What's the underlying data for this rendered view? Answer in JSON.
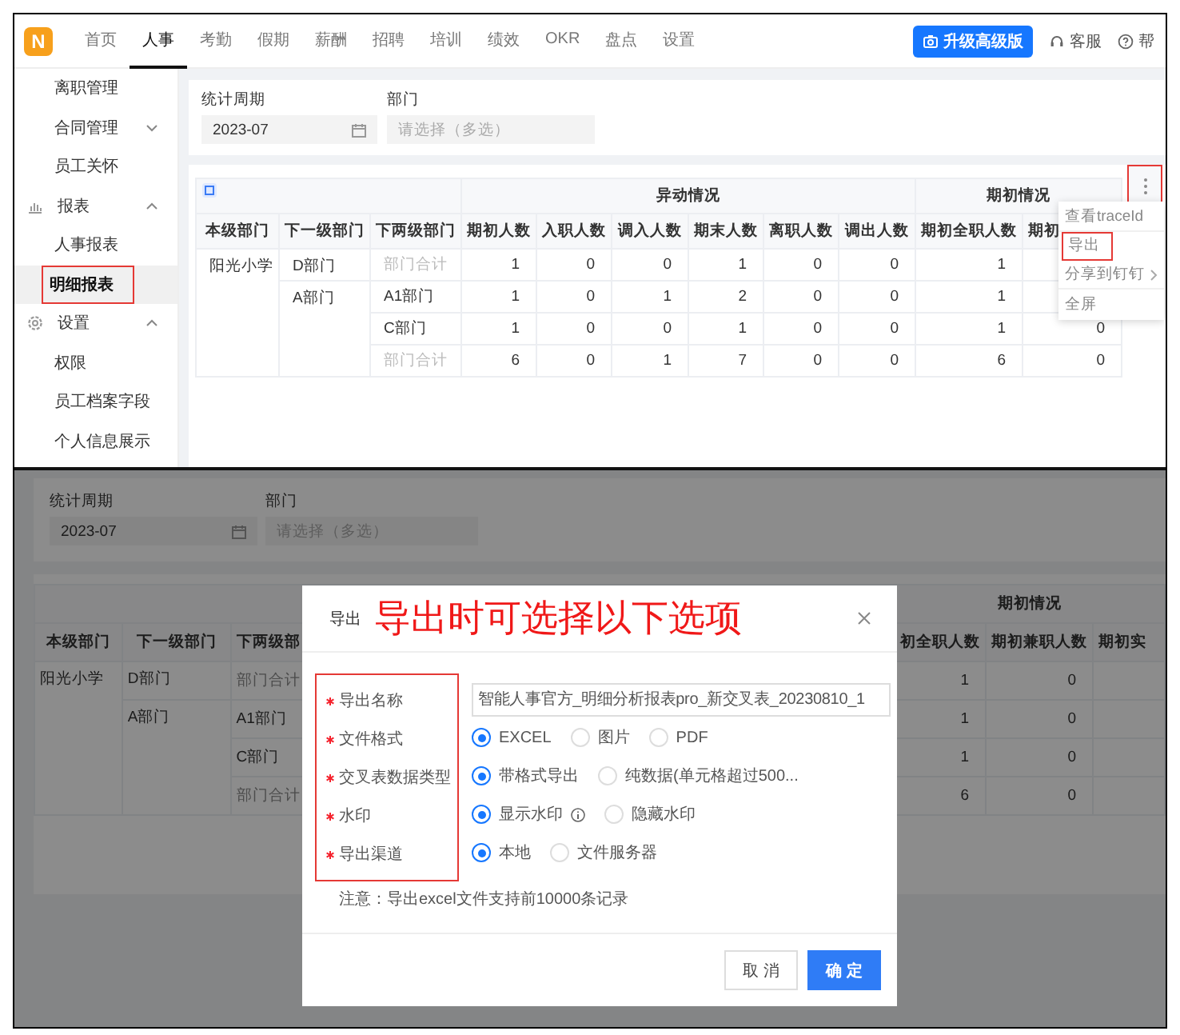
{
  "top": {
    "nav": {
      "logo": "N",
      "tabs": [
        {
          "label": "首页",
          "selected": false
        },
        {
          "label": "人事",
          "selected": true
        },
        {
          "label": "考勤",
          "selected": false
        },
        {
          "label": "假期",
          "selected": false
        },
        {
          "label": "薪酬",
          "selected": false
        },
        {
          "label": "招聘",
          "selected": false
        },
        {
          "label": "培训",
          "selected": false
        },
        {
          "label": "绩效",
          "selected": false
        },
        {
          "label": "OKR",
          "selected": false
        },
        {
          "label": "盘点",
          "selected": false
        },
        {
          "label": "设置",
          "selected": false
        }
      ],
      "upgrade_button": "升级高级版",
      "support": "客服",
      "help": "帮"
    },
    "sidebar": {
      "items": [
        {
          "kind": "item",
          "label": "离职管理",
          "selected": false,
          "highlighted": false
        },
        {
          "kind": "group",
          "label": "合同管理",
          "selected": false,
          "highlighted": false,
          "expanded": false
        },
        {
          "kind": "item",
          "label": "员工关怀",
          "selected": false,
          "highlighted": false
        },
        {
          "kind": "section",
          "label": "报表",
          "selected": false,
          "highlighted": false,
          "expanded": true
        },
        {
          "kind": "item",
          "label": "人事报表",
          "selected": false,
          "highlighted": false
        },
        {
          "kind": "item",
          "label": "明细报表",
          "selected": true,
          "highlighted": true
        },
        {
          "kind": "section",
          "label": "设置",
          "selected": false,
          "highlighted": false,
          "expanded": true
        },
        {
          "kind": "item",
          "label": "权限",
          "selected": false,
          "highlighted": false
        },
        {
          "kind": "item",
          "label": "员工档案字段",
          "selected": false,
          "highlighted": false
        },
        {
          "kind": "item",
          "label": "个人信息展示",
          "selected": false,
          "highlighted": false
        }
      ]
    },
    "filters": {
      "period": {
        "label": "统计周期",
        "value": "2023-07"
      },
      "department": {
        "label": "部门",
        "placeholder": "请选择（多选）"
      }
    },
    "table": {
      "dimension_columns": [
        "本级部门",
        "下一级部门",
        "下两级部门"
      ],
      "column_groups": [
        {
          "label": "异动情况",
          "columns": [
            "期初人数",
            "入职人数",
            "调入人数",
            "期末人数",
            "离职人数",
            "调出人数"
          ]
        },
        {
          "label": "期初情况",
          "columns": [
            "期初全职人数",
            "期初"
          ]
        }
      ],
      "departments": [
        {
          "name": "阳光小学",
          "children": [
            {
              "name": "D部门",
              "children": [
                {
                  "name": "部门合计",
                  "kind": "total",
                  "values": [
                    "1",
                    "0",
                    "0",
                    "1",
                    "0",
                    "0",
                    "1"
                  ]
                }
              ]
            },
            {
              "name": "A部门",
              "children": [
                {
                  "name": "A1部门",
                  "kind": "department",
                  "values": [
                    "1",
                    "0",
                    "1",
                    "2",
                    "0",
                    "0",
                    "1"
                  ]
                },
                {
                  "name": "C部门",
                  "kind": "department",
                  "values": [
                    "1",
                    "0",
                    "0",
                    "1",
                    "0",
                    "0",
                    "1",
                    "0"
                  ]
                },
                {
                  "name": "部门合计",
                  "kind": "total",
                  "values": [
                    "6",
                    "0",
                    "1",
                    "7",
                    "0",
                    "0",
                    "6",
                    "0"
                  ]
                }
              ]
            }
          ]
        }
      ]
    },
    "more_button": {
      "highlighted": true
    },
    "menu": [
      {
        "label": "查看traceId",
        "highlighted": false,
        "submenu": false
      },
      {
        "label": "导出",
        "highlighted": true,
        "submenu": false
      },
      {
        "label": "分享到钉钉",
        "highlighted": false,
        "submenu": true
      },
      {
        "label": "全屏",
        "highlighted": false,
        "submenu": false
      }
    ]
  },
  "bottom": {
    "filters": {
      "period": {
        "label": "统计周期",
        "value": "2023-07"
      },
      "department": {
        "label": "部门",
        "placeholder": "请选择（多选）"
      }
    },
    "table": {
      "dimension_columns": [
        "本级部门",
        "下一级部门",
        "下两级部"
      ],
      "column_groups": [
        {
          "label": "期初情况",
          "columns": [
            "初全职人数",
            "期初兼职人数",
            "期初实"
          ]
        }
      ],
      "departments": [
        {
          "name": "阳光小学",
          "children": [
            {
              "name": "D部门",
              "children": [
                {
                  "name": "部门合计",
                  "kind": "total",
                  "values": [
                    "1",
                    "0"
                  ]
                }
              ]
            },
            {
              "name": "A部门",
              "children": [
                {
                  "name": "A1部门",
                  "kind": "department",
                  "values": [
                    "1",
                    "0"
                  ]
                },
                {
                  "name": "C部门",
                  "kind": "department",
                  "values": [
                    "1",
                    "0"
                  ]
                },
                {
                  "name": "部门合计",
                  "kind": "total",
                  "values": [
                    "6",
                    "0"
                  ]
                }
              ]
            }
          ]
        }
      ]
    },
    "dialog": {
      "title": "导出",
      "annotation": "导出时可选择以下选项",
      "fields": [
        {
          "kind": "text",
          "label": "导出名称",
          "required": true,
          "value": "智能人事官方_明细分析报表pro_新交叉表_20230810_1"
        },
        {
          "kind": "radio",
          "label": "文件格式",
          "required": true,
          "options": [
            {
              "label": "EXCEL",
              "selected": true,
              "info": false
            },
            {
              "label": "图片",
              "selected": false,
              "info": false
            },
            {
              "label": "PDF",
              "selected": false,
              "info": false
            }
          ]
        },
        {
          "kind": "radio",
          "label": "交叉表数据类型",
          "required": true,
          "options": [
            {
              "label": "带格式导出",
              "selected": true,
              "info": false
            },
            {
              "label": "纯数据(单元格超过500...",
              "selected": false,
              "info": false
            }
          ]
        },
        {
          "kind": "radio",
          "label": "水印",
          "required": true,
          "options": [
            {
              "label": "显示水印",
              "selected": true,
              "info": true
            },
            {
              "label": "隐藏水印",
              "selected": false,
              "info": false
            }
          ]
        },
        {
          "kind": "radio",
          "label": "导出渠道",
          "required": true,
          "options": [
            {
              "label": "本地",
              "selected": true,
              "info": false
            },
            {
              "label": "文件服务器",
              "selected": false,
              "info": false
            }
          ]
        }
      ],
      "note": "注意：导出excel文件支持前10000条记录",
      "buttons": [
        {
          "kind": "secondary",
          "label": "取 消"
        },
        {
          "kind": "primary",
          "label": "确 定"
        }
      ]
    }
  }
}
